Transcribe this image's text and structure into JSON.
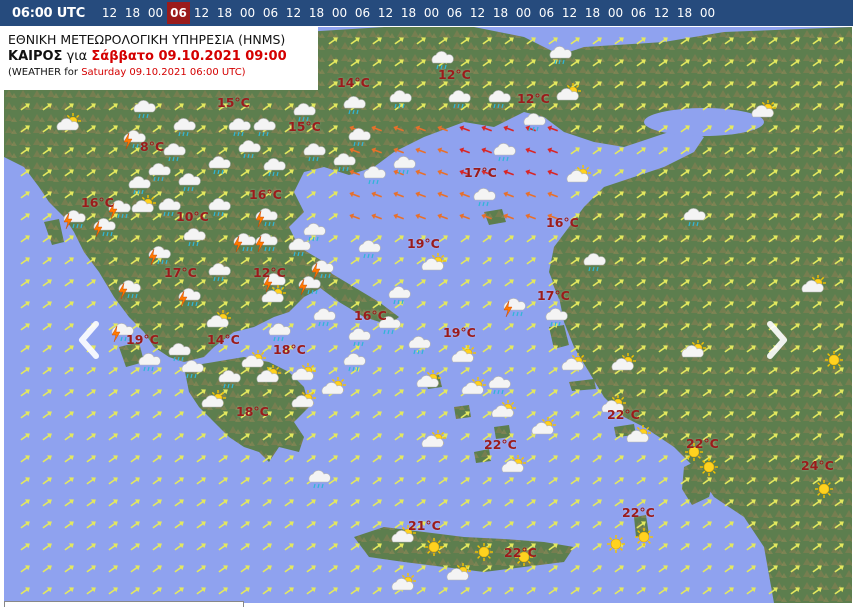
{
  "header": {
    "current_time": "06:00 UTC",
    "hours": [
      "12",
      "18",
      "00",
      "06",
      "12",
      "18",
      "00",
      "06",
      "12",
      "18",
      "00",
      "06",
      "12",
      "18",
      "00",
      "06",
      "12",
      "18",
      "00",
      "06",
      "12",
      "18",
      "00",
      "06",
      "12",
      "18",
      "00"
    ],
    "active_hour_index": 3
  },
  "info": {
    "agency": "ΕΘΝΙΚΗ ΜΕΤΕΩΡΟΛΟΓΙΚΗ ΥΠΗΡΕΣΙΑ (HNMS)",
    "forecast_word": "ΚΑΙΡΟΣ",
    "forecast_for": "για",
    "forecast_date": "Σάββατο 09.10.2021 09:00",
    "weather_for": "(WEATHER for",
    "weather_date": "Saturday 09.10.2021 06:00 UTC)"
  },
  "temperatures": [
    "14°C",
    "12°C",
    "15°C",
    "12°C",
    "15°C",
    "8°C",
    "17°C",
    "16°C",
    "16°C",
    "10°C",
    "16°C",
    "19°C",
    "17°C",
    "12°C",
    "17°C",
    "16°C",
    "19°C",
    "14°C",
    "19°C",
    "18°C",
    "18°C",
    "22°C",
    "22°C",
    "22°C",
    "24°C",
    "22°C",
    "21°C",
    "22°C"
  ],
  "colors": {
    "sea": "#8fa2ef",
    "land": "#5d7e4e",
    "mountain": "#8a7d52",
    "header_bg": "#264b7d",
    "active_hour": "#9b1b1b",
    "temp_text": "#9b1b1b",
    "wind_arrow_light": "#e4e95e",
    "wind_arrow_strong": "#e8702a",
    "wind_arrow_red": "#d92525"
  },
  "icons": {
    "rain": "rain-cloud-icon",
    "thunder": "thunderstorm-icon",
    "sun_cloud": "partly-cloudy-icon",
    "sun": "sun-icon",
    "nav_left": "chevron-left-icon",
    "nav_right": "chevron-right-icon"
  }
}
